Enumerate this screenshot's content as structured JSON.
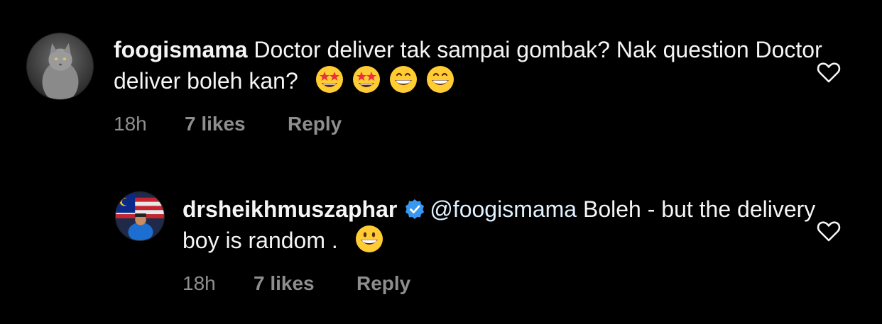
{
  "comments": [
    {
      "username": "foogismama",
      "text": "Doctor deliver tak sampai gombak? Nak question Doctor deliver boleh kan?",
      "emojis": [
        "star-struck-emoji",
        "star-struck-emoji",
        "grinning-emoji",
        "grinning-emoji"
      ],
      "time": "18h",
      "likes": "7 likes",
      "reply_label": "Reply",
      "avatar": "cat-avatar"
    },
    {
      "username": "drsheikhmuszaphar",
      "verified": true,
      "mention": "@foogismama",
      "text": " Boleh - but the delivery boy is random .",
      "emojis": [
        "smiley-emoji"
      ],
      "time": "18h",
      "likes": "7 likes",
      "reply_label": "Reply",
      "avatar": "doctor-avatar"
    }
  ],
  "colors": {
    "background": "#000000",
    "text": "#f5f5f5",
    "meta": "#8e8e8e",
    "verified": "#3897f0",
    "mention": "#e0f1ff"
  }
}
